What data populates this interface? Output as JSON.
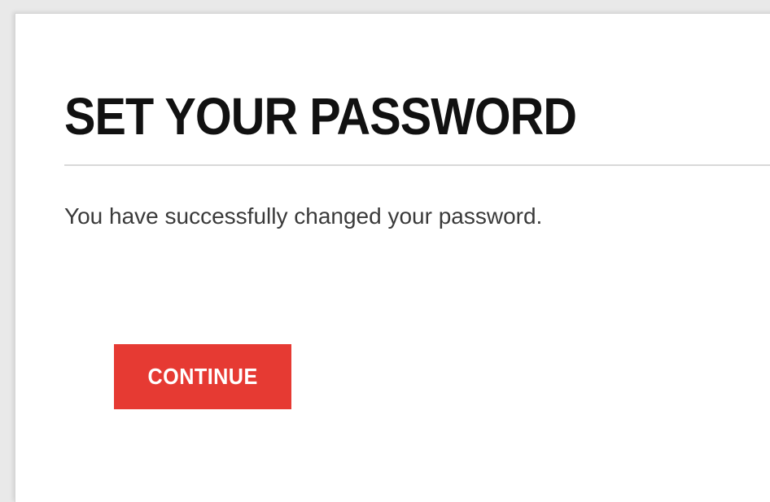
{
  "page": {
    "title": "SET YOUR PASSWORD",
    "message": "You have successfully changed your password."
  },
  "actions": {
    "continue_label": "CONTINUE"
  },
  "colors": {
    "background": "#e9e9e9",
    "card": "#ffffff",
    "title_text": "#111111",
    "body_text": "#3a3a3a",
    "button": "#e63a33",
    "button_text": "#ffffff"
  }
}
